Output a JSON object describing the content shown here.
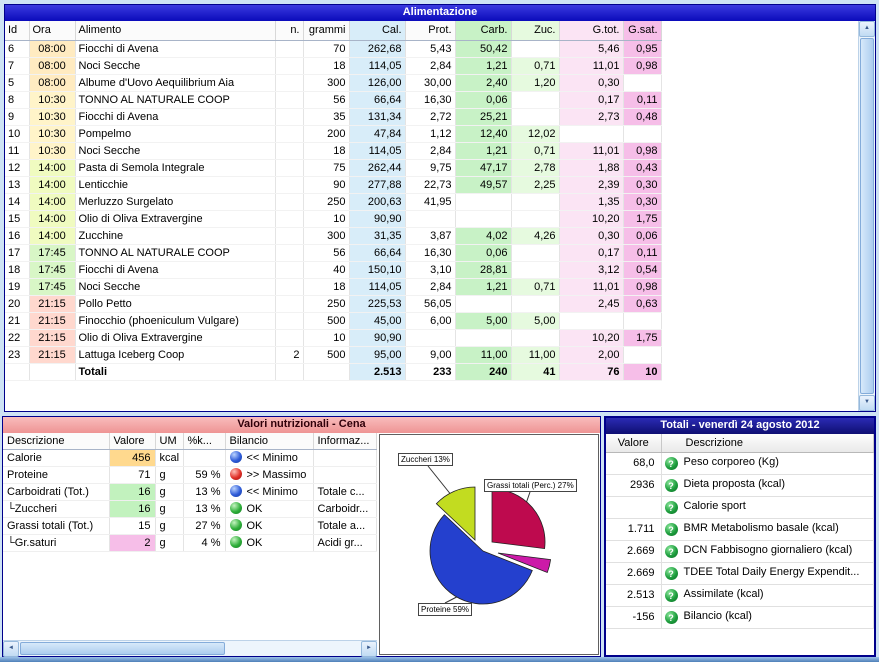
{
  "icons": {
    "up": "▲",
    "down": "▼",
    "left": "◄",
    "right": "►",
    "help": "?"
  },
  "alimentazione": {
    "title": "Alimentazione",
    "columns": [
      {
        "key": "id",
        "label": "Id"
      },
      {
        "key": "ora",
        "label": "Ora"
      },
      {
        "key": "alimento",
        "label": "Alimento"
      },
      {
        "key": "n",
        "label": "n."
      },
      {
        "key": "grammi",
        "label": "grammi"
      },
      {
        "key": "cal",
        "label": "Cal."
      },
      {
        "key": "prot",
        "label": "Prot."
      },
      {
        "key": "carb",
        "label": "Carb."
      },
      {
        "key": "zuc",
        "label": "Zuc."
      },
      {
        "key": "gtot",
        "label": "G.tot."
      },
      {
        "key": "gsat",
        "label": "G.sat."
      }
    ],
    "col_tints": {
      "cal": "#D8EDF9",
      "carb": "#C8F2C6",
      "zuc": "#E6FADF",
      "gtot": "#FBE4F4",
      "gsat": "#F6BEE8"
    },
    "meal_colors": {
      "08:00": "#FFEBC1",
      "10:30": "#FFF4C9",
      "14:00": "#F0FBC0",
      "17:45": "#D8F6C6",
      "21:15": "#FFD8CE"
    },
    "rows": [
      {
        "id": "6",
        "ora": "08:00",
        "alimento": "Fiocchi di Avena",
        "n": "",
        "grammi": "70",
        "cal": "262,68",
        "prot": "5,43",
        "carb": "50,42",
        "zuc": "",
        "gtot": "5,46",
        "gsat": "0,95"
      },
      {
        "id": "7",
        "ora": "08:00",
        "alimento": "Noci Secche",
        "n": "",
        "grammi": "18",
        "cal": "114,05",
        "prot": "2,84",
        "carb": "1,21",
        "zuc": "0,71",
        "gtot": "11,01",
        "gsat": "0,98"
      },
      {
        "id": "5",
        "ora": "08:00",
        "alimento": "Albume d'Uovo Aequilibrium Aia",
        "n": "",
        "grammi": "300",
        "cal": "126,00",
        "prot": "30,00",
        "carb": "2,40",
        "zuc": "1,20",
        "gtot": "0,30",
        "gsat": ""
      },
      {
        "id": "8",
        "ora": "10:30",
        "alimento": "TONNO AL NATURALE COOP",
        "n": "",
        "grammi": "56",
        "cal": "66,64",
        "prot": "16,30",
        "carb": "0,06",
        "zuc": "",
        "gtot": "0,17",
        "gsat": "0,11"
      },
      {
        "id": "9",
        "ora": "10:30",
        "alimento": "Fiocchi di Avena",
        "n": "",
        "grammi": "35",
        "cal": "131,34",
        "prot": "2,72",
        "carb": "25,21",
        "zuc": "",
        "gtot": "2,73",
        "gsat": "0,48"
      },
      {
        "id": "10",
        "ora": "10:30",
        "alimento": "Pompelmo",
        "n": "",
        "grammi": "200",
        "cal": "47,84",
        "prot": "1,12",
        "carb": "12,40",
        "zuc": "12,02",
        "gtot": "",
        "gsat": ""
      },
      {
        "id": "11",
        "ora": "10:30",
        "alimento": "Noci Secche",
        "n": "",
        "grammi": "18",
        "cal": "114,05",
        "prot": "2,84",
        "carb": "1,21",
        "zuc": "0,71",
        "gtot": "11,01",
        "gsat": "0,98"
      },
      {
        "id": "12",
        "ora": "14:00",
        "alimento": "Pasta di Semola Integrale",
        "n": "",
        "grammi": "75",
        "cal": "262,44",
        "prot": "9,75",
        "carb": "47,17",
        "zuc": "2,78",
        "gtot": "1,88",
        "gsat": "0,43"
      },
      {
        "id": "13",
        "ora": "14:00",
        "alimento": "Lenticchie",
        "n": "",
        "grammi": "90",
        "cal": "277,88",
        "prot": "22,73",
        "carb": "49,57",
        "zuc": "2,25",
        "gtot": "2,39",
        "gsat": "0,30"
      },
      {
        "id": "14",
        "ora": "14:00",
        "alimento": "Merluzzo Surgelato",
        "n": "",
        "grammi": "250",
        "cal": "200,63",
        "prot": "41,95",
        "carb": "",
        "zuc": "",
        "gtot": "1,35",
        "gsat": "0,30"
      },
      {
        "id": "15",
        "ora": "14:00",
        "alimento": "Olio di Oliva Extravergine",
        "n": "",
        "grammi": "10",
        "cal": "90,90",
        "prot": "",
        "carb": "",
        "zuc": "",
        "gtot": "10,20",
        "gsat": "1,75"
      },
      {
        "id": "16",
        "ora": "14:00",
        "alimento": "Zucchine",
        "n": "",
        "grammi": "300",
        "cal": "31,35",
        "prot": "3,87",
        "carb": "4,02",
        "zuc": "4,26",
        "gtot": "0,30",
        "gsat": "0,06"
      },
      {
        "id": "17",
        "ora": "17:45",
        "alimento": "TONNO AL NATURALE COOP",
        "n": "",
        "grammi": "56",
        "cal": "66,64",
        "prot": "16,30",
        "carb": "0,06",
        "zuc": "",
        "gtot": "0,17",
        "gsat": "0,11"
      },
      {
        "id": "18",
        "ora": "17:45",
        "alimento": "Fiocchi di Avena",
        "n": "",
        "grammi": "40",
        "cal": "150,10",
        "prot": "3,10",
        "carb": "28,81",
        "zuc": "",
        "gtot": "3,12",
        "gsat": "0,54"
      },
      {
        "id": "19",
        "ora": "17:45",
        "alimento": "Noci Secche",
        "n": "",
        "grammi": "18",
        "cal": "114,05",
        "prot": "2,84",
        "carb": "1,21",
        "zuc": "0,71",
        "gtot": "11,01",
        "gsat": "0,98"
      },
      {
        "id": "20",
        "ora": "21:15",
        "alimento": "Pollo Petto",
        "n": "",
        "grammi": "250",
        "cal": "225,53",
        "prot": "56,05",
        "carb": "",
        "zuc": "",
        "gtot": "2,45",
        "gsat": "0,63"
      },
      {
        "id": "21",
        "ora": "21:15",
        "alimento": "Finocchio (phoeniculum Vulgare)",
        "n": "",
        "grammi": "500",
        "cal": "45,00",
        "prot": "6,00",
        "carb": "5,00",
        "zuc": "5,00",
        "gtot": "",
        "gsat": ""
      },
      {
        "id": "22",
        "ora": "21:15",
        "alimento": "Olio di Oliva Extravergine",
        "n": "",
        "grammi": "10",
        "cal": "90,90",
        "prot": "",
        "carb": "",
        "zuc": "",
        "gtot": "10,20",
        "gsat": "1,75"
      },
      {
        "id": "23",
        "ora": "21:15",
        "alimento": "Lattuga Iceberg Coop",
        "n": "2",
        "grammi": "500",
        "cal": "95,00",
        "prot": "9,00",
        "carb": "11,00",
        "zuc": "11,00",
        "gtot": "2,00",
        "gsat": ""
      }
    ],
    "totals": {
      "label": "Totali",
      "cal": "2.513",
      "prot": "233",
      "carb": "240",
      "zuc": "41",
      "gtot": "76",
      "gsat": "10"
    }
  },
  "nutrition": {
    "title": "Valori nutrizionali - Cena",
    "columns": [
      {
        "key": "desc",
        "label": "Descrizione"
      },
      {
        "key": "val",
        "label": "Valore"
      },
      {
        "key": "um",
        "label": "UM"
      },
      {
        "key": "pct",
        "label": "%k..."
      },
      {
        "key": "bil",
        "label": "Bilancio"
      },
      {
        "key": "info",
        "label": "Informaz..."
      }
    ],
    "rows": [
      {
        "desc": "Calorie",
        "valore": "456",
        "vbg": "#FFD98E",
        "um": "kcal",
        "pct": "",
        "icon": "blue",
        "bilancio": "<< Minimo",
        "info": ""
      },
      {
        "desc": "Proteine",
        "valore": "71",
        "vbg": "",
        "um": "g",
        "pct": "59 %",
        "icon": "red",
        "bilancio": ">> Massimo",
        "info": ""
      },
      {
        "desc": "Carboidrati (Tot.)",
        "valore": "16",
        "vbg": "#C2F2BE",
        "um": "g",
        "pct": "13 %",
        "icon": "blue",
        "bilancio": "<< Minimo",
        "info": "Totale c..."
      },
      {
        "desc": "└Zuccheri",
        "valore": "16",
        "vbg": "#C2F2BE",
        "um": "g",
        "pct": "13 %",
        "icon": "green",
        "bilancio": "OK",
        "info": "Carboidr..."
      },
      {
        "desc": "Grassi totali (Tot.)",
        "valore": "15",
        "vbg": "",
        "um": "g",
        "pct": "27 %",
        "icon": "green",
        "bilancio": "OK",
        "info": "Totale a..."
      },
      {
        "desc": "└Gr.saturi",
        "valore": "2",
        "vbg": "#F6BEE8",
        "um": "g",
        "pct": "4 %",
        "icon": "green",
        "bilancio": "OK",
        "info": "Acidi gr..."
      }
    ],
    "pie": {
      "type": "pie",
      "slices": [
        {
          "key": "proteine",
          "label": "Proteine",
          "percent": 59,
          "color": "#2440CE"
        },
        {
          "key": "grassi",
          "label": "Grassi totali (Perc.)",
          "percent": 27,
          "color": "#BE0A4E"
        },
        {
          "key": "grsaturi",
          "label": "Gr.saturi",
          "percent": 4,
          "color": "#CC1AA8"
        },
        {
          "key": "zuccheri",
          "label": "Zuccheri",
          "percent": 13,
          "color": "#C2DC20"
        }
      ],
      "labels": {
        "zuccheri": "Zuccheri 13%",
        "grassi": "Grassi totali (Perc.) 27%",
        "proteine": "Proteine 59%"
      }
    }
  },
  "totali": {
    "title": "Totali - venerdì 24 agosto 2012",
    "columns": [
      "Valore",
      "Descrizione"
    ],
    "rows": [
      {
        "valore": "68,0",
        "desc": "Peso corporeo (Kg)"
      },
      {
        "valore": "2936",
        "desc": "Dieta proposta (kcal)"
      },
      {
        "valore": "",
        "desc": "Calorie sport"
      },
      {
        "valore": "1.711",
        "desc": "BMR Metabolismo basale (kcal)"
      },
      {
        "valore": "2.669",
        "desc": "DCN Fabbisogno giornaliero (kcal)"
      },
      {
        "valore": "2.669",
        "desc": "TDEE Total Daily Energy Expendit..."
      },
      {
        "valore": "2.513",
        "desc": "Assimilate (kcal)"
      },
      {
        "valore": "-156",
        "desc": "Bilancio (kcal)"
      }
    ]
  }
}
